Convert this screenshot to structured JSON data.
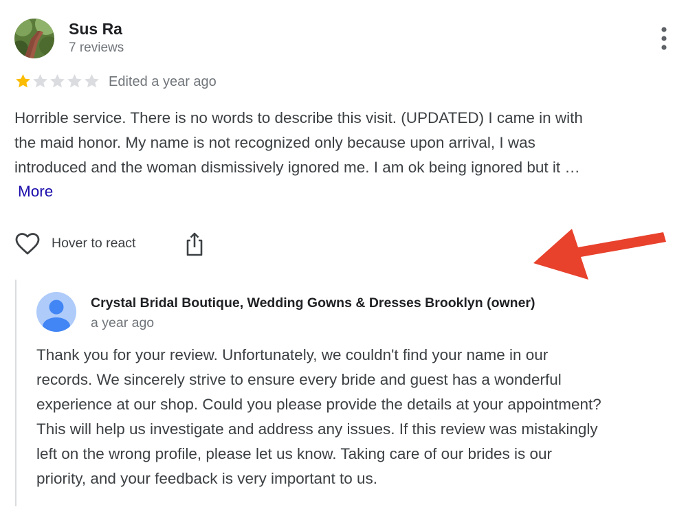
{
  "review": {
    "reviewer_name": "Sus Ra",
    "reviewer_count": "7 reviews",
    "rating": 1,
    "rating_max": 5,
    "edited": "Edited a year ago",
    "text": "Horrible service. There is no words to describe this visit. (UPDATED) I came in with\nthe maid honor. My name is not recognized only because upon arrival, I was\nintroduced and the woman dismissively ignored me. I am ok being ignored but it …",
    "more_label": "More",
    "react_label": "Hover to react"
  },
  "owner_response": {
    "name": "Crystal Bridal Boutique, Wedding Gowns & Dresses Brooklyn (owner)",
    "date": "a year ago",
    "text": "Thank you for your review. Unfortunately, we couldn't find your name in our\nrecords. We sincerely strive to ensure every bride and guest has a wonderful\nexperience at our shop. Could you please provide the details at your appointment?\nThis will help us investigate and address any issues. If this review was mistakingly\nleft on the wrong profile, please let us know. Taking care of our brides is our\npriority, and your feedback is very important to us."
  },
  "icons": {
    "menu": "more-vert-icon",
    "heart": "heart-outline-icon",
    "share": "share-icon",
    "annotation": "red-arrow-icon",
    "owner_avatar": "person-avatar-icon"
  },
  "colors": {
    "star_filled": "#fbbc04",
    "star_empty": "#dadce0",
    "link": "#1a0dab",
    "arrow": "#e8412c",
    "owner_avatar_bg": "#aecbfa",
    "owner_avatar_fg": "#4285f4"
  }
}
